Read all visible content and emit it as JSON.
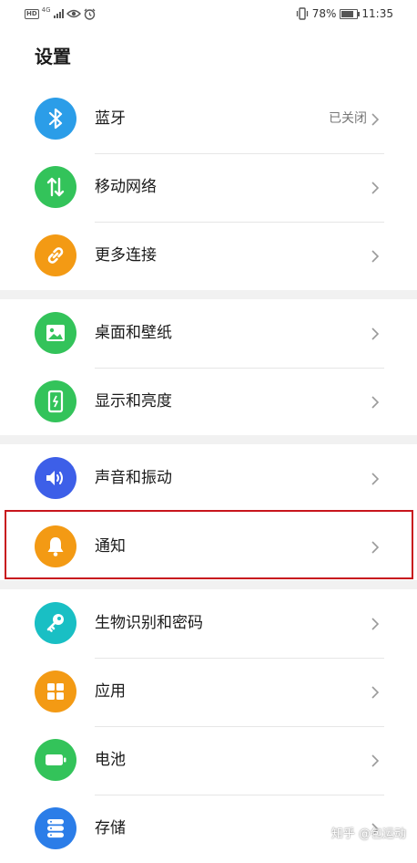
{
  "status_bar": {
    "hd": "HD",
    "network": "4G",
    "battery": "78%",
    "battery_level": 0.78,
    "time": "11:35"
  },
  "page": {
    "title": "设置"
  },
  "settings": [
    {
      "label": "蓝牙",
      "value": "已关闭",
      "icon": "bluetooth-icon",
      "color": "#2b9de8"
    },
    {
      "label": "移动网络",
      "icon": "mobile-data-icon",
      "color": "#33c35a"
    },
    {
      "label": "更多连接",
      "icon": "link-icon",
      "color": "#f39a14"
    },
    {
      "label": "桌面和壁纸",
      "icon": "wallpaper-icon",
      "color": "#33c35a"
    },
    {
      "label": "显示和亮度",
      "icon": "display-icon",
      "color": "#33c35a"
    },
    {
      "label": "声音和振动",
      "icon": "speaker-icon",
      "color": "#3d5fe8"
    },
    {
      "label": "通知",
      "icon": "bell-icon",
      "color": "#f39a14"
    },
    {
      "label": "生物识别和密码",
      "icon": "key-icon",
      "color": "#19bfc4"
    },
    {
      "label": "应用",
      "icon": "apps-grid-icon",
      "color": "#f39a14"
    },
    {
      "label": "电池",
      "icon": "battery-icon",
      "color": "#33c35a"
    },
    {
      "label": "存储",
      "icon": "storage-icon",
      "color": "#2b7de8"
    }
  ],
  "watermark": "知乎 @包运动"
}
